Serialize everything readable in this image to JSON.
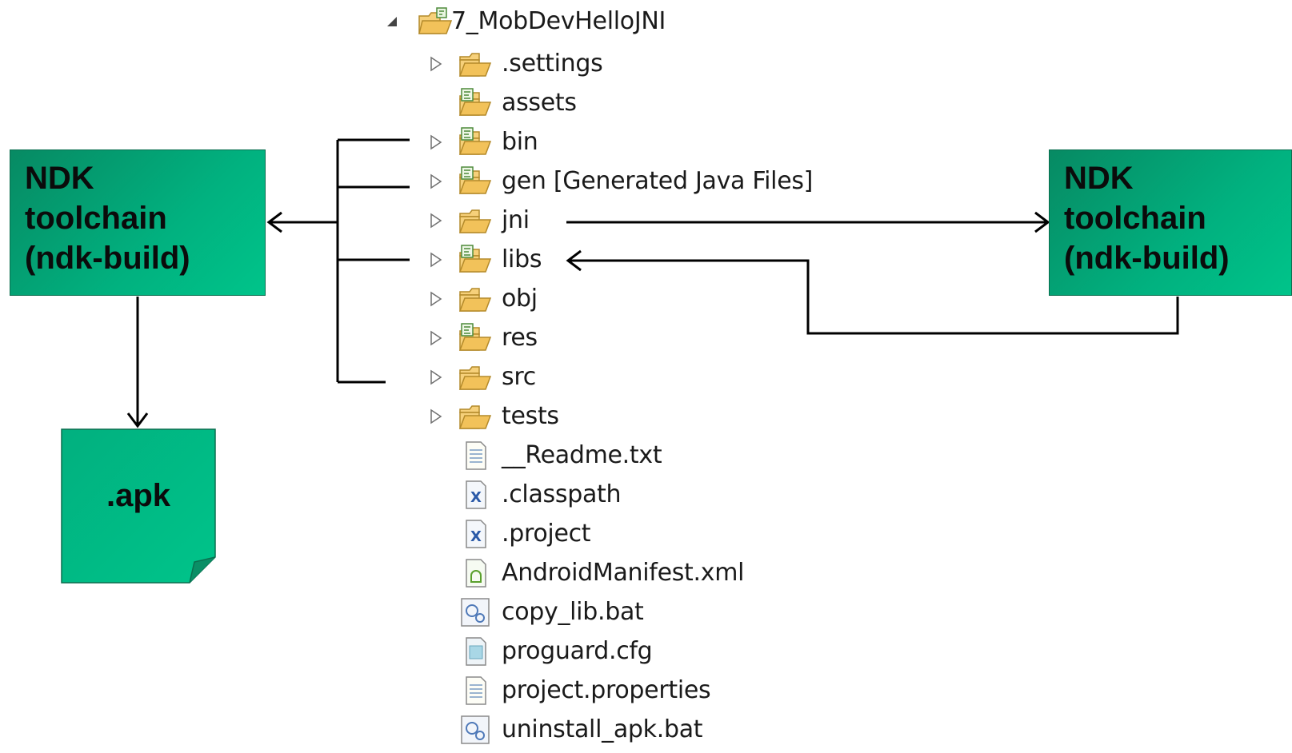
{
  "tree": {
    "root": {
      "label": "7_MobDevHelloJNI"
    },
    "items": [
      {
        "label": ".settings",
        "icon": "folder-icon",
        "expandable": true
      },
      {
        "label": "assets",
        "icon": "source-folder-icon",
        "expandable": false
      },
      {
        "label": "bin",
        "icon": "source-folder-icon",
        "expandable": true
      },
      {
        "label": "gen [Generated Java Files]",
        "icon": "source-folder-icon",
        "expandable": true
      },
      {
        "label": "jni",
        "icon": "folder-icon",
        "expandable": true
      },
      {
        "label": "libs",
        "icon": "source-folder-icon",
        "expandable": true
      },
      {
        "label": "obj",
        "icon": "folder-icon",
        "expandable": true
      },
      {
        "label": "res",
        "icon": "source-folder-icon",
        "expandable": true
      },
      {
        "label": "src",
        "icon": "folder-icon",
        "expandable": true
      },
      {
        "label": "tests",
        "icon": "folder-icon",
        "expandable": true
      },
      {
        "label": "__Readme.txt",
        "icon": "text-file-icon",
        "expandable": false
      },
      {
        "label": ".classpath",
        "icon": "xml-file-icon",
        "expandable": false
      },
      {
        "label": ".project",
        "icon": "xml-file-icon",
        "expandable": false
      },
      {
        "label": "AndroidManifest.xml",
        "icon": "android-manifest-icon",
        "expandable": false
      },
      {
        "label": "copy_lib.bat",
        "icon": "batch-file-icon",
        "expandable": false
      },
      {
        "label": "proguard.cfg",
        "icon": "config-file-icon",
        "expandable": false
      },
      {
        "label": "project.properties",
        "icon": "text-file-icon",
        "expandable": false
      },
      {
        "label": "uninstall_apk.bat",
        "icon": "batch-file-icon",
        "expandable": false
      }
    ]
  },
  "boxes": {
    "left_toolchain": "NDK\ntoolchain\n(ndk-build)",
    "right_toolchain": "NDK\ntoolchain\n(ndk-build)",
    "apk": ".apk"
  },
  "colors": {
    "box_fill": "#00c48a",
    "box_border": "#0b6e4f",
    "folder": "#f2c25a",
    "arrow": "#000000"
  }
}
